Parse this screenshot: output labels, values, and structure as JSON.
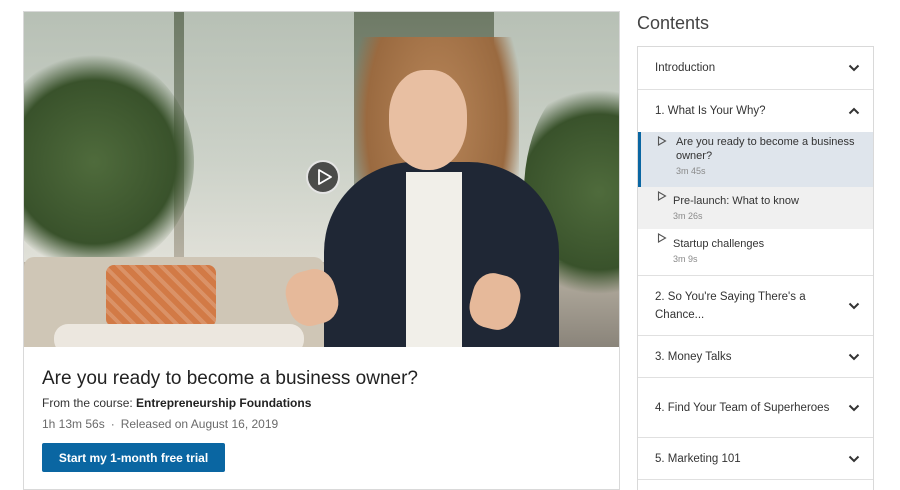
{
  "video": {
    "title": "Are you ready to become a business owner?",
    "from_prefix": "From the course:",
    "course_name": "Entrepreneurship Foundations",
    "duration": "1h 13m 56s",
    "separator": "·",
    "released": "Released on August 16, 2019",
    "cta_label": "Start my 1-month free trial",
    "play_icon": "play-icon"
  },
  "sidebar": {
    "heading": "Contents",
    "chapters": [
      {
        "label": "Introduction",
        "expanded": false
      },
      {
        "label": "1. What Is Your Why?",
        "expanded": true,
        "videos": [
          {
            "title": "Are you ready to become a business owner?",
            "duration": "3m 45s",
            "active": true
          },
          {
            "title": "Pre-launch: What to know",
            "duration": "3m 26s",
            "active": false
          },
          {
            "title": "Startup challenges",
            "duration": "3m 9s",
            "active": false
          }
        ]
      },
      {
        "label": "2. So You're Saying There's a Chance...",
        "expanded": false
      },
      {
        "label": "3. Money Talks",
        "expanded": false
      },
      {
        "label": "4. Find Your Team of Superheroes",
        "expanded": false
      },
      {
        "label": "5. Marketing 101",
        "expanded": false
      }
    ]
  },
  "colors": {
    "brand_blue": "#0a66a2",
    "active_row": "#dfe5ec",
    "hover_row": "#f0f0f0"
  }
}
